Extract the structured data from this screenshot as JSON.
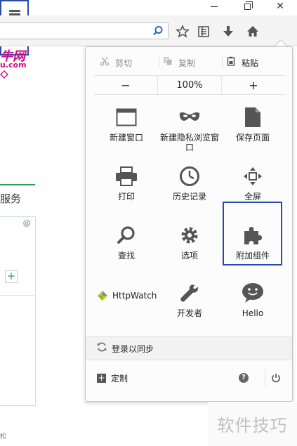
{
  "window": {
    "close_glyph": "✕"
  },
  "background_page": {
    "logo_text": "牛网",
    "logo_sub": "u.com",
    "service_tab": "服务",
    "bottom_text": "松"
  },
  "menu": {
    "edit": {
      "cut": "剪切",
      "copy": "复制",
      "paste": "粘贴"
    },
    "zoom": {
      "out": "−",
      "level": "100%",
      "in": "+"
    },
    "items": [
      {
        "label": "新建窗口"
      },
      {
        "label": "新建隐私浏览窗口"
      },
      {
        "label": "保存页面"
      },
      {
        "label": "打印"
      },
      {
        "label": "历史记录"
      },
      {
        "label": "全屏"
      },
      {
        "label": "查找"
      },
      {
        "label": "选项"
      },
      {
        "label": "附加组件"
      },
      {
        "label": "HttpWatch"
      },
      {
        "label": "开发者"
      },
      {
        "label": "Hello"
      }
    ],
    "sync": "登录以同步",
    "customize": "定制",
    "help_glyph": "?"
  },
  "watermark": "软件技巧",
  "colors": {
    "highlight_border": "#2b4aa8",
    "logo": "#d40a8a",
    "accent_green": "#2e9a5a"
  }
}
